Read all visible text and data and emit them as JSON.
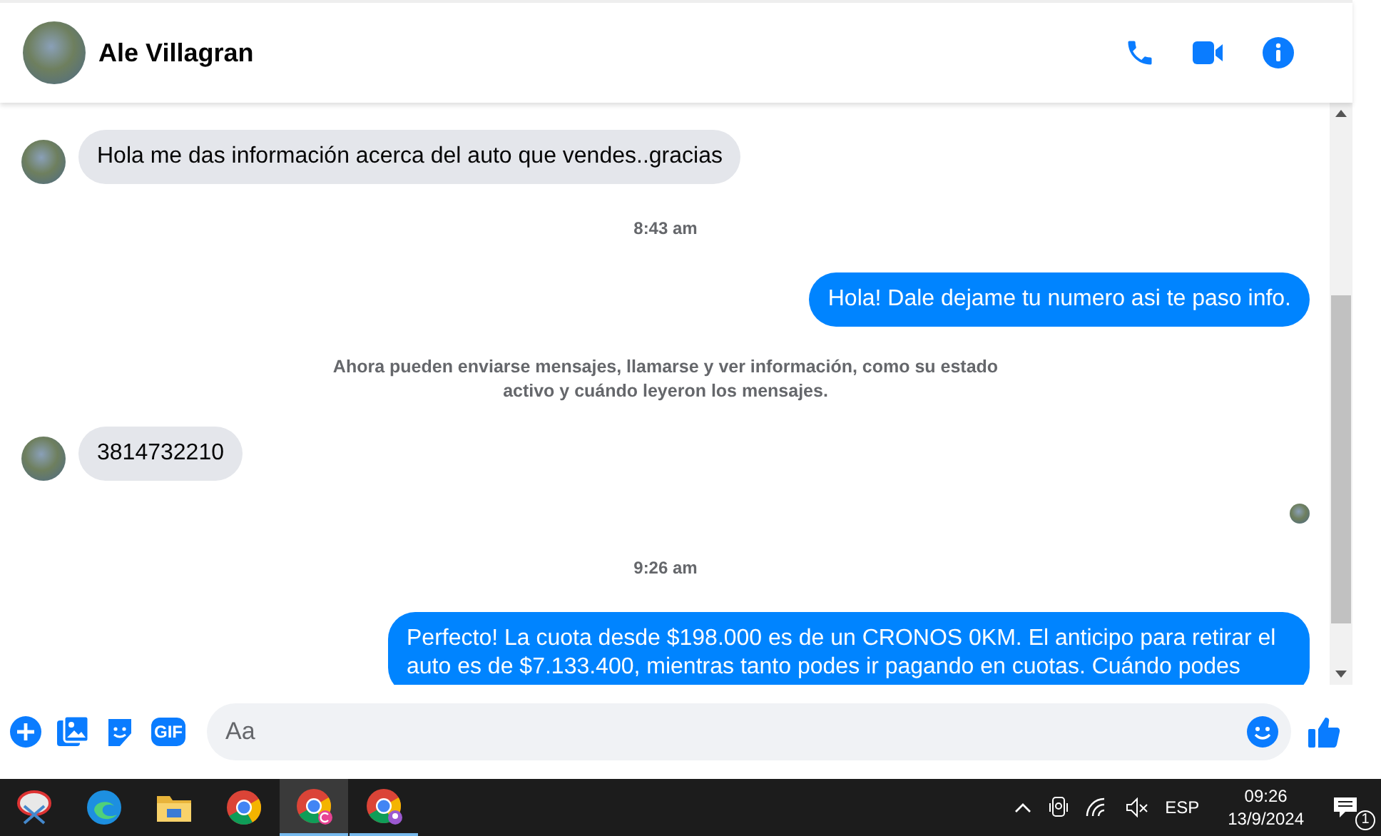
{
  "header": {
    "contact_name": "Ale Villagran"
  },
  "messages": [
    {
      "kind": "incoming",
      "text": "Hola me das información acerca del auto que vendes..gracias"
    },
    {
      "kind": "time",
      "text": "8:43 am"
    },
    {
      "kind": "outgoing",
      "text": "Hola! Dale dejame tu numero  asi te paso info."
    },
    {
      "kind": "notice",
      "text": "Ahora pueden enviarse mensajes, llamarse y ver información, como su estado activo y cuándo leyeron los mensajes."
    },
    {
      "kind": "incoming",
      "text": "3814732210"
    },
    {
      "kind": "seen"
    },
    {
      "kind": "time",
      "text": "9:26 am"
    },
    {
      "kind": "outgoing",
      "text": "Perfecto! La cuota desde $198.000 es de un CRONOS 0KM. El anticipo para retirar el auto es de $7.133.400, mientras tanto podes ir pagando en cuotas. Cuándo podes"
    }
  ],
  "composer": {
    "gif_label": "GIF",
    "placeholder": "Aa"
  },
  "taskbar": {
    "apps": [
      {
        "kind": "snip",
        "active": false,
        "running": false
      },
      {
        "kind": "edge",
        "active": false,
        "running": false
      },
      {
        "kind": "folder",
        "active": false,
        "running": false
      },
      {
        "kind": "chrome",
        "active": false,
        "running": false
      },
      {
        "kind": "chrome-c",
        "active": true,
        "running": true
      },
      {
        "kind": "chrome-p",
        "active": false,
        "running": true
      }
    ],
    "language": "ESP",
    "time": "09:26",
    "date": "13/9/2024",
    "notification_count": "1"
  }
}
